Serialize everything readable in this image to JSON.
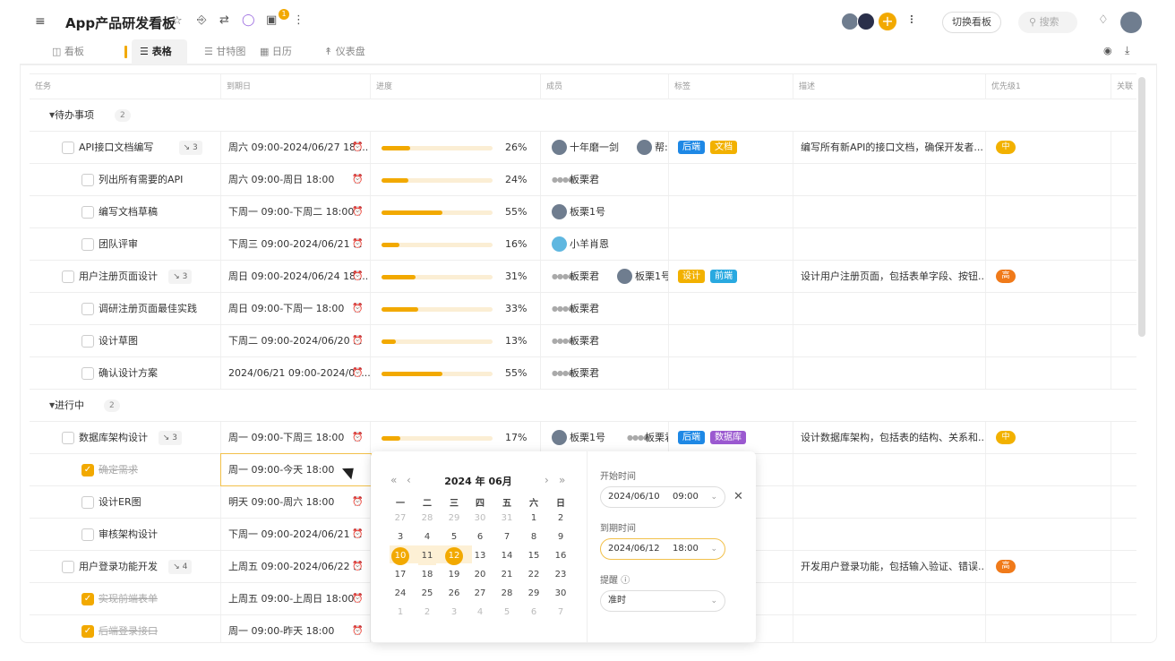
{
  "app": {
    "title": "App产品研发看板",
    "notif_count": "1",
    "switch_label": "切换看板",
    "search_placeholder": "搜索",
    "accent": "#f2a900"
  },
  "tabs": [
    {
      "label": "看板",
      "icon": "kanban-icon"
    },
    {
      "label": "表格",
      "icon": "table-icon",
      "active": true
    },
    {
      "label": "甘特图",
      "icon": "gantt-icon"
    },
    {
      "label": "日历",
      "icon": "calendar-icon"
    },
    {
      "label": "仪表盘",
      "icon": "dashboard-icon"
    }
  ],
  "columns": [
    "任务",
    "到期日",
    "进度",
    "成员",
    "标签",
    "描述",
    "优先级1",
    "关联"
  ],
  "groups": [
    {
      "title": "待办事项",
      "count": "2"
    },
    {
      "title": "进行中",
      "count": "2"
    }
  ],
  "rows": [
    {
      "name": "API接口文档编写",
      "sub": "3",
      "due": "周六 09:00-2024/06/27 18:...",
      "progress": 26,
      "pct": "26%",
      "members": [
        "十年磨一剑",
        "帮:"
      ],
      "tags": [
        {
          "t": "后端",
          "c": "#1e88e5"
        },
        {
          "t": "文档",
          "c": "#f2b100"
        }
      ],
      "desc": "编写所有新API的接口文档，确保开发者...",
      "prio": {
        "t": "中",
        "c": "#f2b100"
      }
    },
    {
      "name": "列出所有需要的API",
      "due": "周六 09:00-周日 18:00",
      "progress": 24,
      "pct": "24%",
      "members": [
        "板栗君"
      ]
    },
    {
      "name": "编写文档草稿",
      "due": "下周一 09:00-下周二 18:00",
      "progress": 55,
      "pct": "55%",
      "members": [
        "板栗1号"
      ]
    },
    {
      "name": "团队评审",
      "due": "下周三 09:00-2024/06/21 ...",
      "progress": 16,
      "pct": "16%",
      "members": [
        "小羊肖恩"
      ]
    },
    {
      "name": "用户注册页面设计",
      "sub": "3",
      "due": "周日 09:00-2024/06/24 18:...",
      "progress": 31,
      "pct": "31%",
      "members": [
        "板栗君",
        "板栗1号"
      ],
      "tags": [
        {
          "t": "设计",
          "c": "#f2b100"
        },
        {
          "t": "前端",
          "c": "#29a9e0"
        }
      ],
      "desc": "设计用户注册页面，包括表单字段、按钮...",
      "prio": {
        "t": "高",
        "c": "#f07a1a"
      }
    },
    {
      "name": "调研注册页面最佳实践",
      "due": "周日 09:00-下周一 18:00",
      "progress": 33,
      "pct": "33%",
      "members": [
        "板栗君"
      ]
    },
    {
      "name": "设计草图",
      "due": "下周二 09:00-2024/06/20 ...",
      "progress": 13,
      "pct": "13%",
      "members": [
        "板栗君"
      ]
    },
    {
      "name": "确认设计方案",
      "due": "2024/06/21 09:00-2024/06...",
      "progress": 55,
      "pct": "55%",
      "members": [
        "板栗君"
      ]
    },
    {
      "name": "数据库架构设计",
      "sub": "3",
      "due": "周一 09:00-下周三 18:00",
      "progress": 17,
      "pct": "17%",
      "members": [
        "板栗1号",
        "板栗君"
      ],
      "tags": [
        {
          "t": "后端",
          "c": "#1e88e5"
        },
        {
          "t": "数据库",
          "c": "#9b59d0"
        }
      ],
      "desc": "设计数据库架构，包括表的结构、关系和...",
      "prio": {
        "t": "中",
        "c": "#f2b100"
      }
    },
    {
      "name": "确定需求",
      "due": "周一 09:00-今天 18:00"
    },
    {
      "name": "设计ER图",
      "due": "明天 09:00-周六 18:00"
    },
    {
      "name": "审核架构设计",
      "due": "下周一 09:00-2024/06/21 ..."
    },
    {
      "name": "用户登录功能开发",
      "sub": "4",
      "due": "上周五 09:00-2024/06/22 ...",
      "desc": "开发用户登录功能，包括输入验证、错误...",
      "prio": {
        "t": "高",
        "c": "#f07a1a"
      }
    },
    {
      "name": "实现前端表单",
      "due": "上周五 09:00-上周日 18:00"
    },
    {
      "name": "后端登录接口",
      "due": "周一 09:00-昨天 18:00"
    }
  ],
  "calendar": {
    "year_month": "2024 年  06月",
    "dow": [
      "一",
      "二",
      "三",
      "四",
      "五",
      "六",
      "日"
    ],
    "weeks": [
      [
        "27",
        "28",
        "29",
        "30",
        "31",
        "1",
        "2"
      ],
      [
        "3",
        "4",
        "5",
        "6",
        "7",
        "8",
        "9"
      ],
      [
        "10",
        "11",
        "12",
        "13",
        "14",
        "15",
        "16"
      ],
      [
        "17",
        "18",
        "19",
        "20",
        "21",
        "22",
        "23"
      ],
      [
        "24",
        "25",
        "26",
        "27",
        "28",
        "29",
        "30"
      ],
      [
        "1",
        "2",
        "3",
        "4",
        "5",
        "6",
        "7"
      ]
    ],
    "start_label": "开始时间",
    "start_date": "2024/06/10",
    "start_time": "09:00",
    "due_label": "到期时间",
    "due_date": "2024/06/12",
    "due_time": "18:00",
    "remind_label": "提醒",
    "remind_value": "准时"
  }
}
